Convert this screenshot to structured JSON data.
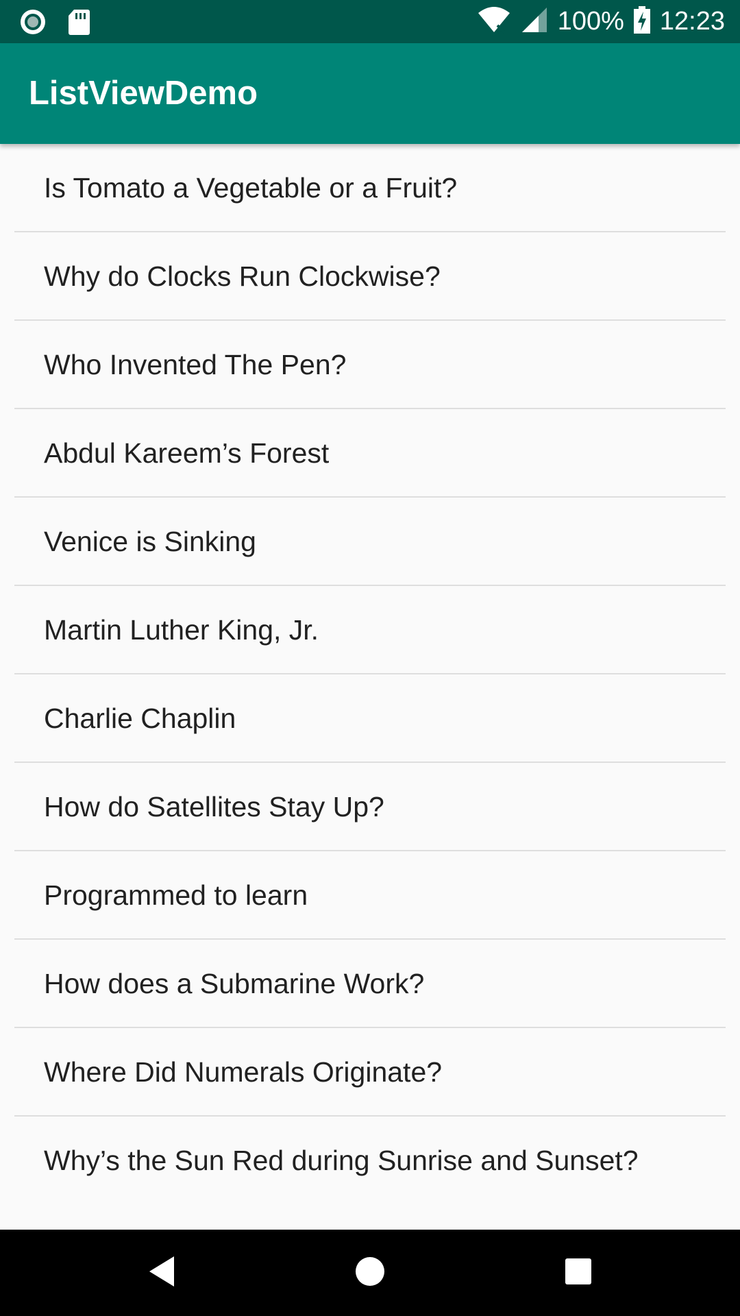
{
  "status_bar": {
    "battery_text": "100%",
    "time": "12:23",
    "icons": [
      "camera-notification-icon",
      "sd-card-icon",
      "wifi-icon",
      "cell-signal-icon",
      "battery-charging-icon"
    ]
  },
  "app_bar": {
    "title": "ListViewDemo",
    "color": "#008577",
    "status_color": "#00574b"
  },
  "list": {
    "items": [
      "Is Tomato a Vegetable or a Fruit?",
      "Why do Clocks Run Clockwise?",
      "Who Invented The Pen?",
      "Abdul Kareem’s Forest",
      "Venice is Sinking",
      "Martin Luther King, Jr.",
      "Charlie Chaplin",
      "How do Satellites Stay Up?",
      "Programmed to learn",
      "How does a Submarine Work?",
      "Where Did Numerals Originate?",
      "Why’s the Sun Red during Sunrise and Sunset?"
    ]
  },
  "nav_bar": {
    "icons": [
      "back-icon",
      "home-icon",
      "recents-icon"
    ]
  }
}
